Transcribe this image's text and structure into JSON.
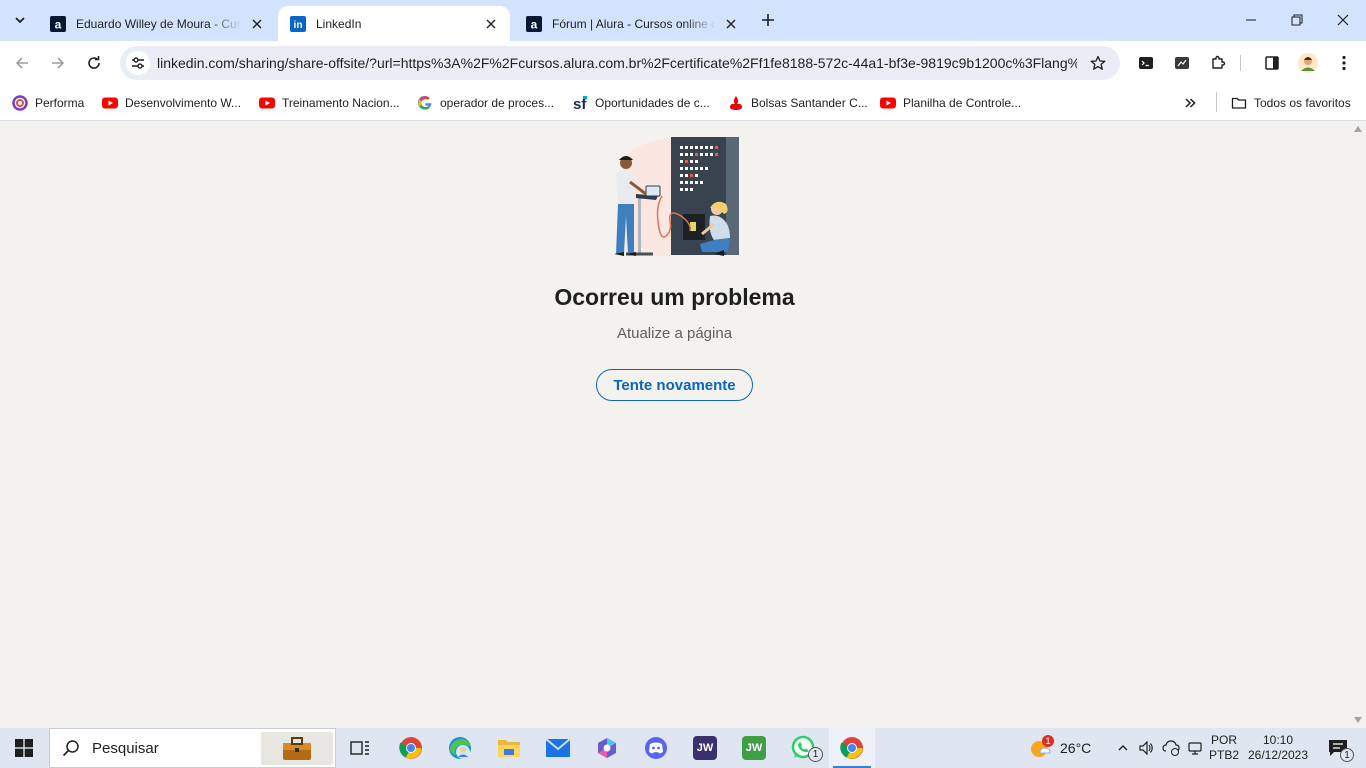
{
  "tabs": [
    {
      "title": "Eduardo Willey de Moura - Cursos",
      "favicon": "alura-icon",
      "active": false
    },
    {
      "title": "LinkedIn",
      "favicon": "linkedin-icon",
      "active": true
    },
    {
      "title": "Fórum | Alura - Cursos online de",
      "favicon": "alura-icon",
      "active": false
    }
  ],
  "omnibox": {
    "url": "linkedin.com/sharing/share-offsite/?url=https%3A%2F%2Fcursos.alura.com.br%2Fcertificate%2Ff1fe8188-572c-44a1-bf3e-9819c9b1200c%3Flang%..."
  },
  "bookmarks": [
    {
      "label": "Performa",
      "icon": "performa-icon"
    },
    {
      "label": "Desenvolvimento W...",
      "icon": "youtube-icon"
    },
    {
      "label": "Treinamento Nacion...",
      "icon": "youtube-icon"
    },
    {
      "label": "operador de proces...",
      "icon": "google-icon"
    },
    {
      "label": "Oportunidades de c...",
      "icon": "sf-icon"
    },
    {
      "label": "Bolsas Santander C...",
      "icon": "santander-icon"
    },
    {
      "label": "Planilha de Controle...",
      "icon": "youtube-icon"
    }
  ],
  "bookmarks_folder": {
    "label": "Todos os favoritos"
  },
  "error": {
    "title": "Ocorreu um problema",
    "subtitle": "Atualize a página",
    "button": "Tente novamente"
  },
  "taskbar": {
    "search_label": "Pesquisar",
    "weather": "26°C",
    "weather_badge": "1",
    "language_1": "POR",
    "language_2": "PTB2",
    "time": "10:10",
    "date": "26/12/2023",
    "notif_count": "1",
    "whatsapp_badge": "1"
  },
  "colors": {
    "linkedin_blue": "#0a66c2",
    "tabstrip": "#d3e3fd",
    "page_bg": "#f3f2ef"
  }
}
